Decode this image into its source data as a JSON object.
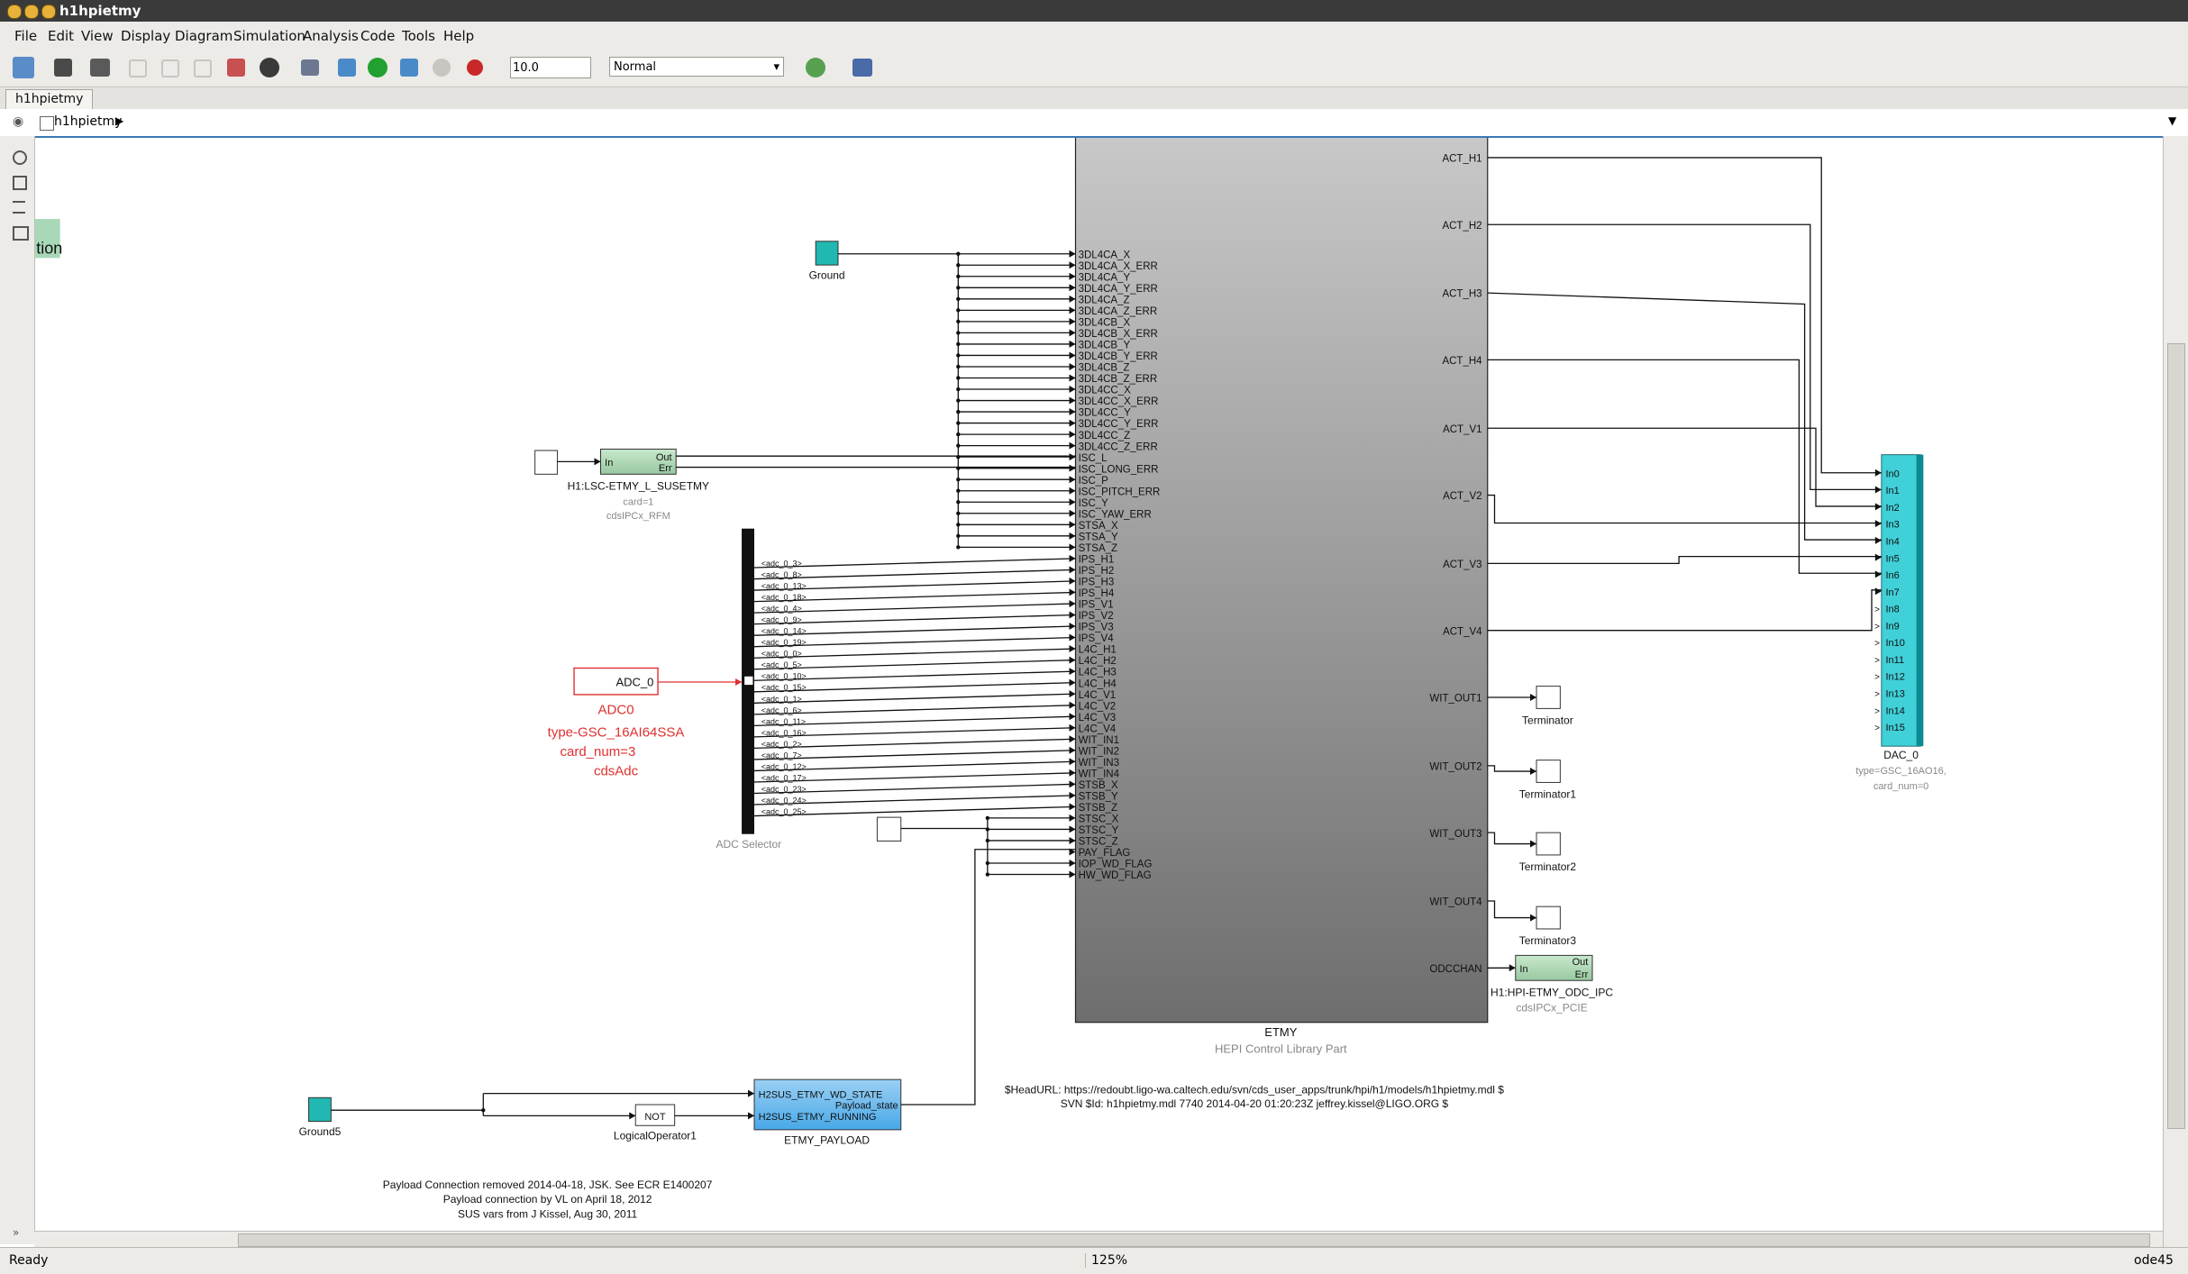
{
  "window": {
    "title": "h1hpietmy"
  },
  "menu": [
    "File",
    "Edit",
    "View",
    "Display",
    "Diagram",
    "Simulation",
    "Analysis",
    "Code",
    "Tools",
    "Help"
  ],
  "toolbar": {
    "stop_time": "10.0",
    "sim_mode": "Normal"
  },
  "tab": {
    "label": "h1hpietmy"
  },
  "address": {
    "path": "h1hpietmy"
  },
  "status": {
    "left": "Ready",
    "zoom": "125%",
    "right": "ode45"
  },
  "partial_block_label": "tion",
  "etmy": {
    "name": "ETMY",
    "sublabel": "HEPI Control Library Part",
    "inputs": [
      "3DL4CA_X",
      "3DL4CA_X_ERR",
      "3DL4CA_Y",
      "3DL4CA_Y_ERR",
      "3DL4CA_Z",
      "3DL4CA_Z_ERR",
      "3DL4CB_X",
      "3DL4CB_X_ERR",
      "3DL4CB_Y",
      "3DL4CB_Y_ERR",
      "3DL4CB_Z",
      "3DL4CB_Z_ERR",
      "3DL4CC_X",
      "3DL4CC_X_ERR",
      "3DL4CC_Y",
      "3DL4CC_Y_ERR",
      "3DL4CC_Z",
      "3DL4CC_Z_ERR",
      "ISC_L",
      "ISC_LONG_ERR",
      "ISC_P",
      "ISC_PITCH_ERR",
      "ISC_Y",
      "ISC_YAW_ERR",
      "STSA_X",
      "STSA_Y",
      "STSA_Z",
      "IPS_H1",
      "IPS_H2",
      "IPS_H3",
      "IPS_H4",
      "IPS_V1",
      "IPS_V2",
      "IPS_V3",
      "IPS_V4",
      "L4C_H1",
      "L4C_H2",
      "L4C_H3",
      "L4C_H4",
      "L4C_V1",
      "L4C_V2",
      "L4C_V3",
      "L4C_V4",
      "WIT_IN1",
      "WIT_IN2",
      "WIT_IN3",
      "WIT_IN4",
      "STSB_X",
      "STSB_Y",
      "STSB_Z",
      "STSC_X",
      "STSC_Y",
      "STSC_Z",
      "PAY_FLAG",
      "IOP_WD_FLAG",
      "HW_WD_FLAG"
    ],
    "outputs": [
      "ACT_H1",
      "ACT_H2",
      "ACT_H3",
      "ACT_H4",
      "ACT_V1",
      "ACT_V2",
      "ACT_V3",
      "ACT_V4",
      "WIT_OUT1",
      "WIT_OUT2",
      "WIT_OUT3",
      "WIT_OUT4",
      "ODCCHAN"
    ]
  },
  "adc_selector": {
    "label": "ADC Selector",
    "signals": [
      "<adc_0_3>",
      "<adc_0_8>",
      "<adc_0_13>",
      "<adc_0_18>",
      "<adc_0_4>",
      "<adc_0_9>",
      "<adc_0_14>",
      "<adc_0_19>",
      "<adc_0_0>",
      "<adc_0_5>",
      "<adc_0_10>",
      "<adc_0_15>",
      "<adc_0_1>",
      "<adc_0_6>",
      "<adc_0_11>",
      "<adc_0_16>",
      "<adc_0_2>",
      "<adc_0_7>",
      "<adc_0_12>",
      "<adc_0_17>",
      "<adc_0_23>",
      "<adc_0_24>",
      "<adc_0_25>"
    ]
  },
  "adc_block": {
    "text": "ADC_0",
    "name": "ADC0",
    "lines": [
      "type-GSC_16AI64SSA",
      "card_num=3",
      "cdsAdc"
    ]
  },
  "dac": {
    "name": "DAC_0",
    "lines": [
      "type=GSC_16AO16,",
      "card_num=0"
    ],
    "inputs": [
      "In0",
      "In1",
      "In2",
      "In3",
      "In4",
      "In5",
      "In6",
      "In7",
      "In8",
      "In9",
      "In10",
      "In11",
      "In12",
      "In13",
      "In14",
      "In15"
    ]
  },
  "ground1": {
    "label": "Ground"
  },
  "ground5": {
    "label": "Ground5"
  },
  "lsc_block": {
    "in": "In",
    "out": "Out",
    "err": "Err",
    "name": "H1:LSC-ETMY_L_SUSETMY",
    "lines": [
      "card=1",
      "cdsIPCx_RFM"
    ]
  },
  "odc_block": {
    "in": "In",
    "out": "Out",
    "err": "Err",
    "name": "H1:HPI-ETMY_ODC_IPC",
    "lines": [
      "cdsIPCx_PCIE"
    ]
  },
  "terminators": [
    "Terminator",
    "Terminator1",
    "Terminator2",
    "Terminator3"
  ],
  "not_block": {
    "text": "NOT",
    "name": "LogicalOperator1"
  },
  "payload": {
    "name": "ETMY_PAYLOAD",
    "in1": "H2SUS_ETMY_WD_STATE",
    "in2": "H2SUS_ETMY_RUNNING",
    "out": "Payload_state"
  },
  "svn": {
    "line1": "$HeadURL: https://redoubt.ligo-wa.caltech.edu/svn/cds_user_apps/trunk/hpi/h1/models/h1hpietmy.mdl $",
    "line2": "SVN $Id: h1hpietmy.mdl 7740 2014-04-20 01:20:23Z jeffrey.kissel@LIGO.ORG $"
  },
  "notes": [
    "Payload Connection removed 2014-04-18, JSK. See ECR E1400207",
    "Payload connection by VL on April 18, 2012",
    "SUS vars from J Kissel, Aug 30, 2011"
  ],
  "colors": {
    "etmy_top": "#c8c8c8",
    "etmy_bottom": "#6e6e6e",
    "dac": "#40d0d8",
    "ground": "#20b8b0",
    "payload": "#48a8e8",
    "ipc_block": "#98c8a0",
    "adc_red": "#e03030",
    "partial_block": "#a8d8b8"
  }
}
